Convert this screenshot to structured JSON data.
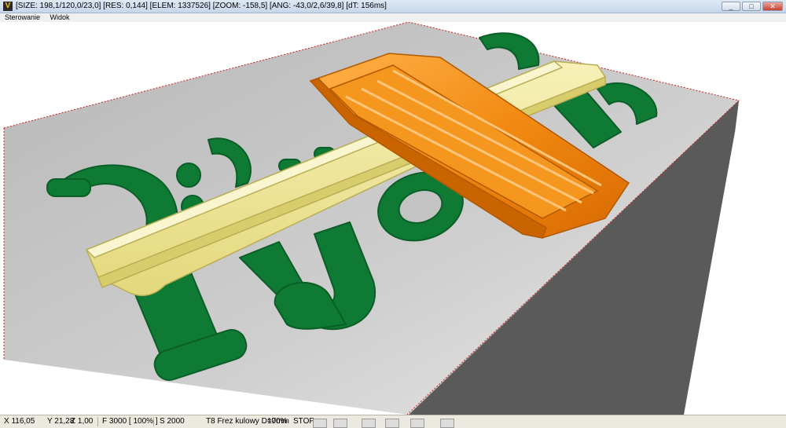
{
  "window": {
    "icon_letter": "V",
    "title": "[SIZE: 198,1/120,0/23,0] [RES: 0,144] [ELEM: 1337526] [ZOOM: -158,5] [ANG: -43,0/2,6/39,8] [dT: 156ms]",
    "minimize_glyph": "_",
    "maximize_glyph": "□",
    "close_glyph": "✕"
  },
  "menu": {
    "items": [
      "Sterowanie",
      "Widok"
    ]
  },
  "status": {
    "x": "X 116,05",
    "y": "Y 21,28",
    "z": "Z 1,00",
    "feed": "F 3000 [ 100% ]",
    "spindle": "S 2000",
    "tool": "T8 Frez kulowy D=7mm",
    "progress": "100%",
    "state": "STOP"
  },
  "colors": {
    "base_top": "#c4c4c4",
    "base_front": "#a9a9a9",
    "base_side": "#6b6b6b",
    "text_relief": "#0f7a34",
    "yellow_pocket": "#efe79a",
    "orange_pocket": "#f28a12",
    "edge_dots": "#d02020"
  },
  "scene": {
    "relief_text": [
      "D.J",
      "UNO",
      "NC"
    ]
  }
}
